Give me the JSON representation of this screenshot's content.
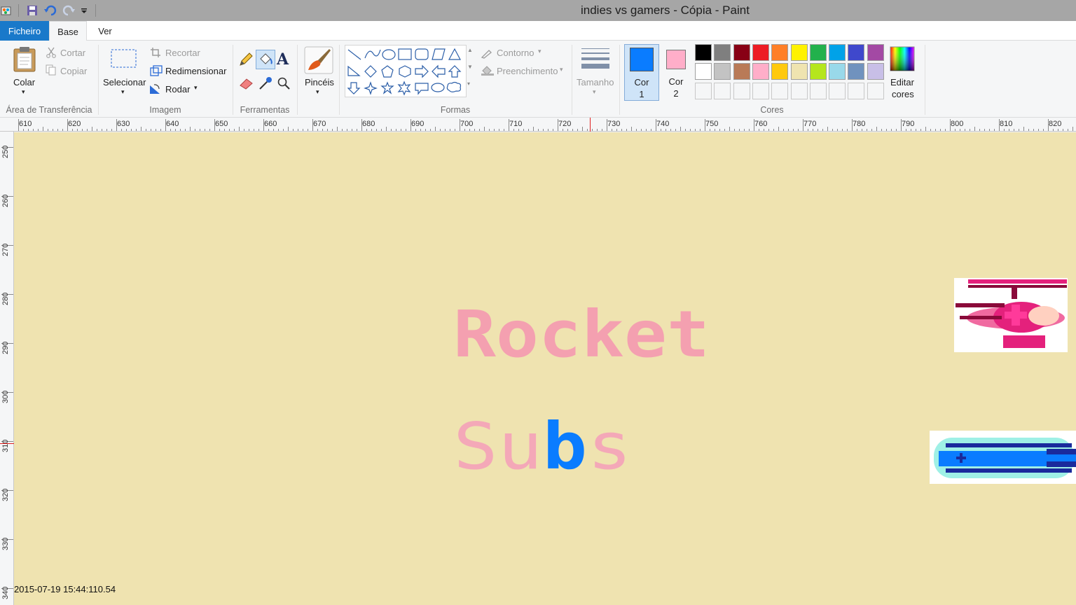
{
  "window": {
    "title": "indies vs gamers - Cópia - Paint"
  },
  "quick_access": {
    "save_icon": "save-icon",
    "undo_icon": "undo-icon",
    "redo_icon": "redo-icon"
  },
  "tabs": {
    "file": "Ficheiro",
    "home": "Base",
    "view": "Ver"
  },
  "clipboard": {
    "paste": "Colar",
    "cut": "Cortar",
    "copy": "Copiar",
    "label": "Área de Transferência"
  },
  "image": {
    "select": "Selecionar",
    "crop": "Recortar",
    "resize": "Redimensionar",
    "rotate": "Rodar",
    "label": "Imagem"
  },
  "tools": {
    "label": "Ferramentas"
  },
  "brushes": {
    "label": "Pincéis"
  },
  "shapes": {
    "outline": "Contorno",
    "fill": "Preenchimento",
    "label": "Formas"
  },
  "size": {
    "label": "Tamanho"
  },
  "colors": {
    "color1_line1": "Cor",
    "color1_line2": "1",
    "color2_line1": "Cor",
    "color2_line2": "2",
    "color1_value": "#0a7cff",
    "color2_value": "#ffaec9",
    "edit_line1": "Editar",
    "edit_line2": "cores",
    "label": "Cores",
    "palette": [
      "#000000",
      "#7f7f7f",
      "#880015",
      "#ed1c24",
      "#ff7f27",
      "#fff200",
      "#22b14c",
      "#00a2e8",
      "#3f48cc",
      "#a349a4",
      "#ffffff",
      "#c3c3c3",
      "#b97a57",
      "#ffaec9",
      "#ffc90e",
      "#efe4b0",
      "#b5e61d",
      "#99d9ea",
      "#7092be",
      "#c8bfe7"
    ]
  },
  "rulers": {
    "horizontal": [
      "610",
      "620",
      "630",
      "640",
      "650",
      "660",
      "670",
      "680",
      "690",
      "700",
      "710",
      "720",
      "730",
      "740",
      "750",
      "760",
      "770",
      "780",
      "790",
      "800",
      "810",
      "820"
    ],
    "vertical": [
      "250",
      "260",
      "270",
      "280",
      "290",
      "300",
      "310",
      "320",
      "330",
      "340"
    ]
  },
  "canvas": {
    "background": "#efe3b0",
    "title_line1": "Rocket",
    "title_line2_a": "Su",
    "title_line2_b": "b",
    "title_line2_c": "s",
    "timestamp": "2015-07-19 15:44:110.54"
  }
}
